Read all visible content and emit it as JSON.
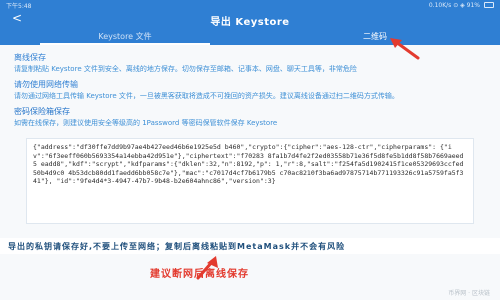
{
  "status_bar": {
    "time": "下午5:48",
    "right": "0.10K/s ⊙ ◈ 91%"
  },
  "header": {
    "title": "导出 Keystore",
    "back_icon": "back-arrow-icon"
  },
  "tabs": [
    {
      "label": "Keystore 文件"
    },
    {
      "label": "二维码"
    }
  ],
  "info": {
    "offline_title": "离线保存",
    "offline_text": "请复制粘贴 Keystore 文件到安全、离线的地方保存。切勿保存至邮箱、记事本、网盘、聊天工具等，非常危险",
    "no_network_title": "请勿使用网络传输",
    "no_network_text": "请勿通过网络工具传输 Keystore 文件，一旦被黑客获取将造成不可挽回的资产损失。建议离线设备通过扫二维码方式传输。",
    "password_title": "密码保险箱保存",
    "password_text": "如需在线保存，则建议使用安全等级高的 1Password 等密码保管软件保存 Keystore"
  },
  "keystore_json": "{\"address\":\"df30ffe7dd9b97ae4b427eed46b6e1925e5d b460\",\"crypto\":{\"cipher\":\"aes-128-ctr\",\"cipherparams\": {\"iv\":\"6f3eeff060b5693354a14ebba42d951e\"},\"ciphertext\":\"f70283 8fa1b7d4fe2f2ed03558b71e36f5d8fe5b1dd8f58b7669aeed5 eadd8\",\"kdf\":\"scrypt\",\"kdfparams\":{\"dklen\":32,\"n\":8192,\"p\": 1,\"r\":8,\"salt\":\"f254fa5d1902415f1ce05329693ccfed50b4d9c0 4b53dcb80dd1faedd6bb058c7e\"},\"mac\":\"c7017d4cf7b6179b5 c70ac8210f3ba6ad97875714b771193326c91a5759fa5f341\"}, \"id\":\"9fe4d4*3-4947-47b7-9b48-b2e604ahnc86\",\"version\":3}",
  "notice": "导出的私钥请保存好,不要上传至网络；复制后离线粘贴到MetaMask并不会有风险",
  "caption": "建议断网后离线保存",
  "watermark": "币界网 · 区块链"
}
